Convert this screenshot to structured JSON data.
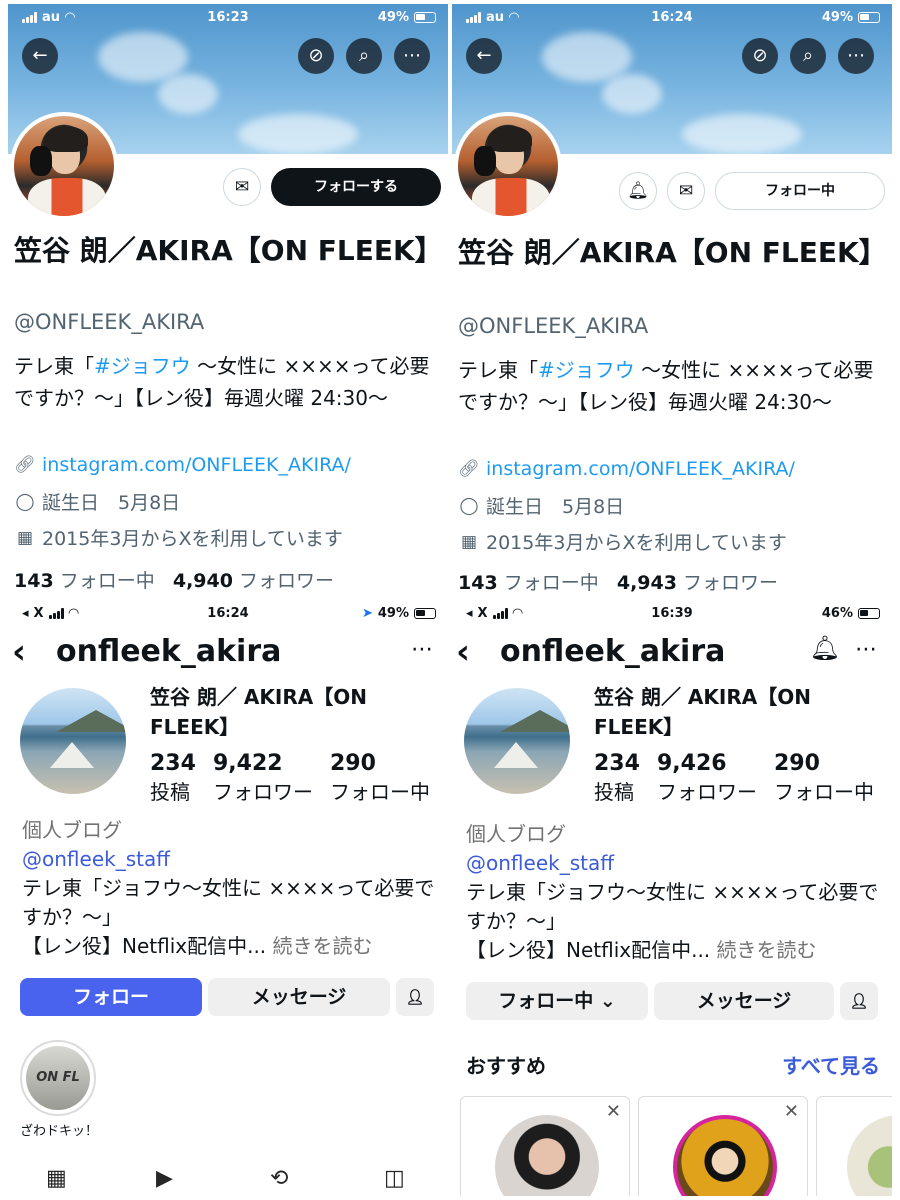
{
  "x_panels": [
    {
      "status": {
        "carrier": "au",
        "time": "16:23",
        "battery": "49%",
        "battery_level": 0.49
      },
      "name": "笠谷 朗／AKIRA【ON FLEEK】",
      "handle": "@ONFLEEK_AKIRA",
      "bio_prefix": "テレ東「",
      "bio_tag": "#ジョフウ",
      "bio_rest": " 〜女性に ××××って必要ですか？〜」【レン役】毎週火曜 24:30〜",
      "link": "instagram.com/ONFLEEK_AKIRA/",
      "birthday": "誕生日　5月8日",
      "joined": "2015年3月からXを利用しています",
      "following_count": "143",
      "following_label": "フォロー中",
      "followers_count": "4,940",
      "followers_label": "フォロワー",
      "follow_button": "フォローする"
    },
    {
      "status": {
        "carrier": "au",
        "time": "16:24",
        "battery": "49%",
        "battery_level": 0.49
      },
      "name": "笠谷 朗／AKIRA【ON FLEEK】",
      "handle": "@ONFLEEK_AKIRA",
      "bio_prefix": "テレ東「",
      "bio_tag": "#ジョフウ",
      "bio_rest": " 〜女性に ××××って必要ですか？〜」【レン役】毎週火曜 24:30〜",
      "link": "instagram.com/ONFLEEK_AKIRA/",
      "birthday": "誕生日　5月8日",
      "joined": "2015年3月からXを利用しています",
      "following_count": "143",
      "following_label": "フォロー中",
      "followers_count": "4,943",
      "followers_label": "フォロワー",
      "follow_button": "フォロー中"
    }
  ],
  "ig_panels": [
    {
      "status": {
        "carrier": "X",
        "time": "16:24",
        "battery": "49%",
        "battery_level": 0.49
      },
      "username": "onfleek_akira",
      "display_name": "笠谷 朗／ AKIRA【ON FLEEK】",
      "posts_count": "234",
      "posts_label": "投稿",
      "followers_count": "9,422",
      "followers_label": "フォロワー",
      "following_count": "290",
      "following_label": "フォロー中",
      "category": "個人ブログ",
      "mention": "@onfleek_staff",
      "bio_line1": "テレ東「ジョフウ〜女性に ××××って必要ですか？〜」",
      "bio_line2": "【レン役】Netflix配信中...",
      "more": " 続きを読む",
      "follow_button": "フォロー",
      "message_button": "メッセージ",
      "highlight_label": "ざわドキッ！",
      "highlight_text": "ON FL"
    },
    {
      "status": {
        "carrier": "X",
        "time": "16:39",
        "battery": "46%",
        "battery_level": 0.46
      },
      "username": "onfleek_akira",
      "display_name": "笠谷 朗／ AKIRA【ON FLEEK】",
      "posts_count": "234",
      "posts_label": "投稿",
      "followers_count": "9,426",
      "followers_label": "フォロワー",
      "following_count": "290",
      "following_label": "フォロー中",
      "category": "個人ブログ",
      "mention": "@onfleek_staff",
      "bio_line1": "テレ東「ジョフウ〜女性に ××××って必要ですか？〜」",
      "bio_line2": "【レン役】Netflix配信中...",
      "more": " 続きを読む",
      "follow_button": "フォロー中 ⌄",
      "message_button": "メッセージ",
      "suggestions_title": "おすすめ",
      "see_all": "すべて見る"
    }
  ],
  "colors": {
    "x_link": "#1d9bf0",
    "ig_blue": "#4a63ee",
    "ig_mention": "#3b5bdb",
    "x_black": "#0f1419"
  }
}
